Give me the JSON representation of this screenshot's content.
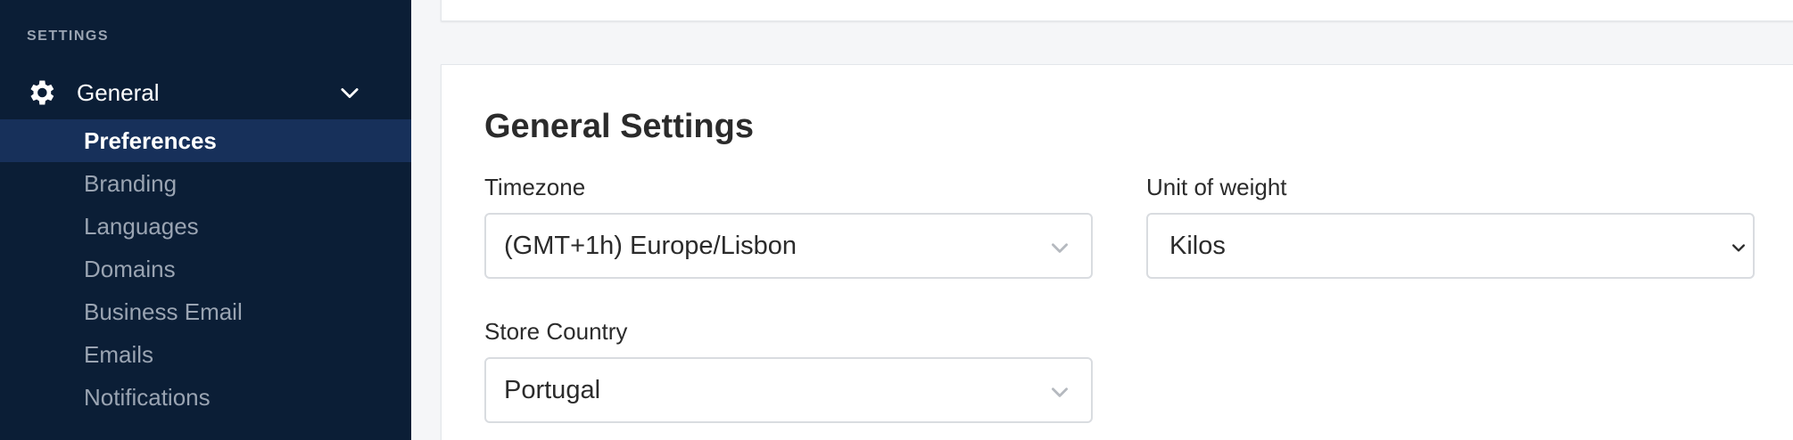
{
  "sidebar": {
    "section_label": "SETTINGS",
    "group": {
      "label": "General",
      "icon": "gear-icon",
      "expand_icon": "chevron-down-icon"
    },
    "items": [
      {
        "label": "Preferences",
        "active": true
      },
      {
        "label": "Branding",
        "active": false
      },
      {
        "label": "Languages",
        "active": false
      },
      {
        "label": "Domains",
        "active": false
      },
      {
        "label": "Business Email",
        "active": false
      },
      {
        "label": "Emails",
        "active": false
      },
      {
        "label": "Notifications",
        "active": false
      }
    ]
  },
  "main": {
    "title": "General Settings",
    "fields": {
      "timezone": {
        "label": "Timezone",
        "value": "(GMT+1h) Europe/Lisbon"
      },
      "unit_of_weight": {
        "label": "Unit of weight",
        "value": "Kilos"
      },
      "store_country": {
        "label": "Store Country",
        "value": "Portugal"
      }
    }
  },
  "colors": {
    "sidebar_bg": "#0b1e36",
    "sidebar_active_bg": "#17305a",
    "sidebar_muted_text": "#9aa4b2",
    "page_bg": "#f5f6f8",
    "card_bg": "#ffffff",
    "input_border": "#d9dce0"
  }
}
